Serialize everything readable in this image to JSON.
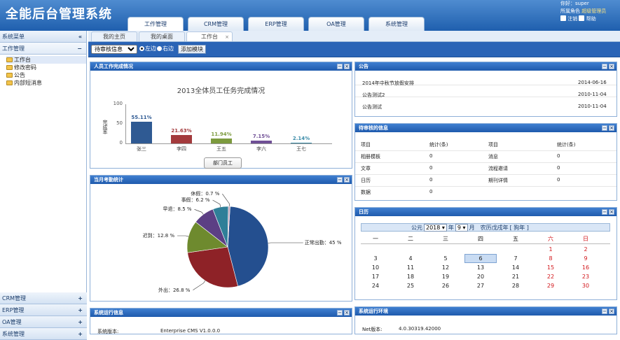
{
  "app": {
    "title": "全能后台管理系统"
  },
  "topnav": [
    "工作管理",
    "CRM管理",
    "ERP管理",
    "OA管理",
    "系统管理"
  ],
  "user": {
    "prefix": "你好：",
    "name": "super",
    "role_label": "所属角色",
    "role_value": "超级管理员",
    "logout": "注销",
    "help": "帮助"
  },
  "sidebar": {
    "header": "系统菜单",
    "collapse_glyph": "«",
    "group": "工作管理",
    "group_toggle": "−",
    "items": [
      "工作台",
      "修改密码",
      "公告",
      "内部短消息"
    ],
    "bottom": [
      {
        "label": "CRM管理",
        "toggle": "+"
      },
      {
        "label": "ERP管理",
        "toggle": "+"
      },
      {
        "label": "OA管理",
        "toggle": "+"
      },
      {
        "label": "系统管理",
        "toggle": "+"
      }
    ]
  },
  "tabs": [
    {
      "label": "我的主页"
    },
    {
      "label": "我的桌面"
    },
    {
      "label": "工作台",
      "close": "×"
    }
  ],
  "toolbar": {
    "select_value": "待审核信息",
    "radio_left": "左边",
    "radio_right": "右边",
    "add_button": "添加模块"
  },
  "panels": {
    "staff": {
      "title": "人员工作完成情况",
      "button": "部门员工"
    },
    "attendance": {
      "title": "当月考勤统计"
    },
    "sysinfo": {
      "title": "系统运行信息",
      "label": "系统版本:",
      "value": "Enterprise CMS V1.0.0.0"
    },
    "notice": {
      "title": "公告",
      "rows": [
        {
          "text": "2014年中秋节放假安排",
          "date": "2014-06-16"
        },
        {
          "text": "公告测试2",
          "date": "2010-11-04"
        },
        {
          "text": "公告测试",
          "date": "2010-11-04"
        }
      ]
    },
    "pending": {
      "title": "待审核的信息",
      "head": [
        "项目",
        "统计(条)",
        "项目",
        "统计(条)"
      ],
      "rows": [
        [
          "相册模板",
          "0",
          "消息",
          "0"
        ],
        [
          "文章",
          "0",
          "流程邀请",
          "0"
        ],
        [
          "日历",
          "0",
          "期刊详情",
          "0"
        ],
        [
          "数据",
          "0",
          "",
          ""
        ]
      ]
    },
    "calendar": {
      "title": "日历",
      "prefix": "公元",
      "year": "2018",
      "year_unit": "年",
      "month": "9",
      "month_unit": "月",
      "lunar": "农历戊戌年",
      "zodiac": "[ 狗年 ]",
      "weekdays": [
        "一",
        "二",
        "三",
        "四",
        "五",
        "六",
        "日"
      ],
      "weeks": [
        [
          "",
          "",
          "",
          "",
          "",
          "1",
          "2"
        ],
        [
          "3",
          "4",
          "5",
          "6",
          "7",
          "8",
          "9"
        ],
        [
          "10",
          "11",
          "12",
          "13",
          "14",
          "15",
          "16"
        ],
        [
          "17",
          "18",
          "19",
          "20",
          "21",
          "22",
          "23"
        ],
        [
          "24",
          "25",
          "26",
          "27",
          "28",
          "29",
          "30"
        ]
      ],
      "today": "6"
    },
    "env": {
      "title": "系统运行环境",
      "label": "Net版本:",
      "value": "4.0.30319.42000"
    }
  },
  "colors": {
    "header": "#2a64b6",
    "panel_header": "#2f6cc0",
    "weekend": "#d2171b"
  },
  "chart_data": [
    {
      "type": "bar",
      "title": "2013全体员工任务完成情况",
      "ylabel": "完成率",
      "categories": [
        "张三",
        "李四",
        "王五",
        "李六",
        "王七"
      ],
      "values": [
        55.11,
        21.63,
        11.94,
        7.15,
        2.14
      ],
      "data_labels": [
        "55.11%",
        "21.63%",
        "11.94%",
        "7.15%",
        "2.14%"
      ],
      "colors": [
        "#2f5a93",
        "#a33a3c",
        "#7c9a3e",
        "#6f4f95",
        "#3a8ba8"
      ],
      "ylim": [
        0,
        100
      ],
      "yticks": [
        0,
        50,
        100
      ],
      "grid": false
    },
    {
      "type": "pie",
      "labels": [
        "正常出勤",
        "外出",
        "迟到",
        "早退",
        "事假",
        "休假"
      ],
      "values": [
        45,
        26.8,
        12.8,
        8.5,
        6.2,
        0.7
      ],
      "display": [
        "正常出勤：45 %",
        "外出：26.8 %",
        "迟到：12.8 %",
        "早退：8.5 %",
        "事假：6.2 %",
        "休假：0.7 %"
      ],
      "colors": [
        "#244f8f",
        "#8e2227",
        "#6e8a2e",
        "#5c3f84",
        "#2f7f98",
        "#c8a4b8"
      ]
    }
  ]
}
